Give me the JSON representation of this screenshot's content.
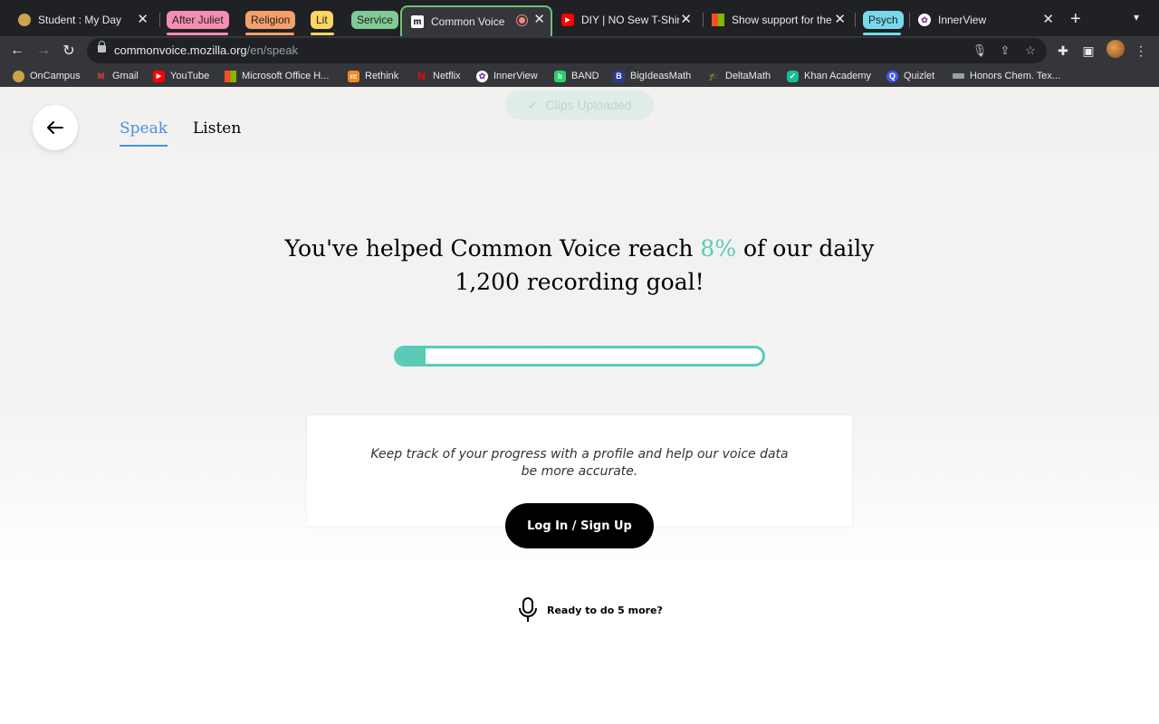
{
  "browser": {
    "tabs": [
      {
        "title": "Student : My Day",
        "icon": "school-seal-icon"
      },
      {
        "title": "Common Voice",
        "icon": "common-voice-m-icon"
      },
      {
        "title": "DIY | NO Sew T-Shirt",
        "icon": "youtube-icon"
      },
      {
        "title": "Show support for the",
        "icon": "microsoft-icon"
      },
      {
        "title": "InnerView",
        "icon": "innerview-icon"
      }
    ],
    "tab_groups": [
      {
        "label": "After Juliet",
        "color": "#f48fb1"
      },
      {
        "label": "Religion",
        "color": "#f5a06b"
      },
      {
        "label": "Lit",
        "color": "#fdd663"
      },
      {
        "label": "Service",
        "color": "#81c995"
      },
      {
        "label": "Psych",
        "color": "#78d9ec"
      }
    ],
    "address": {
      "domain": "commonvoice.mozilla.org",
      "path": "/en/speak"
    },
    "bookmarks": [
      {
        "label": "OnCampus",
        "icon": "school-seal-icon",
        "color": "#c9a44b"
      },
      {
        "label": "Gmail",
        "icon": "gmail-icon",
        "color": "#ea4335"
      },
      {
        "label": "YouTube",
        "icon": "youtube-icon",
        "color": "#ff0000"
      },
      {
        "label": "Microsoft Office H...",
        "icon": "microsoft-icon",
        "color": "#f25022"
      },
      {
        "label": "Rethink",
        "icon": "rethink-icon",
        "color": "#f08a24"
      },
      {
        "label": "Netflix",
        "icon": "netflix-icon",
        "color": "#e50914"
      },
      {
        "label": "InnerView",
        "icon": "innerview-icon",
        "color": "#ffffff"
      },
      {
        "label": "BAND",
        "icon": "band-icon",
        "color": "#2ad168"
      },
      {
        "label": "BigIdeasMath",
        "icon": "bigideasmath-icon",
        "color": "#2a3b8f"
      },
      {
        "label": "DeltaMath",
        "icon": "deltamath-icon",
        "color": "#444444"
      },
      {
        "label": "Khan Academy",
        "icon": "khan-academy-icon",
        "color": "#14bf96"
      },
      {
        "label": "Quizlet",
        "icon": "quizlet-icon",
        "color": "#4255ff"
      },
      {
        "label": "Honors Chem. Tex...",
        "icon": "book-icon",
        "color": "#9aa0a6"
      }
    ]
  },
  "page": {
    "toast": "Clips Uploaded",
    "nav": {
      "speak": "Speak",
      "listen": "Listen"
    },
    "headline": {
      "before": "You've helped Common Voice reach ",
      "percent": "8%",
      "after": " of our daily 1,200 recording goal!"
    },
    "progress_fraction": 0.08,
    "card_text": "Keep track of your progress with a profile and help our voice data be more accurate.",
    "login_label": "Log In / Sign Up",
    "more_label": "Ready to do 5 more?",
    "colors": {
      "accent": "#59cbb7",
      "link": "#4a90d9",
      "button": "#000000"
    }
  }
}
